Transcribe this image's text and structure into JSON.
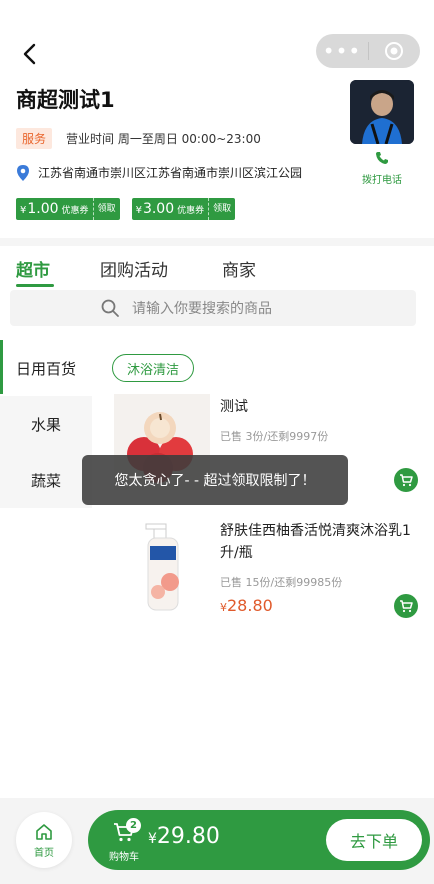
{
  "topbar": {
    "back_icon": "chevron-left-icon",
    "more_icon": "more-dots-icon",
    "close_icon": "target-icon"
  },
  "store": {
    "name": "商超测试1",
    "service_tag": "服务",
    "hours": "营业时间 周一至周日 00:00~23:00",
    "address": "江苏省南通市崇川区江苏省南通市崇川区滨江公园",
    "call_label": "拨打电话"
  },
  "coupons": [
    {
      "currency": "¥",
      "amount": "1.00",
      "kind": "优惠券",
      "action": "领取"
    },
    {
      "currency": "¥",
      "amount": "3.00",
      "kind": "优惠券",
      "action": "领取"
    }
  ],
  "tabs": [
    {
      "label": "超市"
    },
    {
      "label": "团购活动"
    },
    {
      "label": "商家"
    }
  ],
  "search": {
    "placeholder": "请输入你要搜索的商品"
  },
  "categories": [
    {
      "label": "日用百货"
    },
    {
      "label": "水果"
    },
    {
      "label": "蔬菜"
    }
  ],
  "subcategory": {
    "label": "沐浴清洁"
  },
  "products": [
    {
      "title": "测试",
      "sold": "已售 3份/还剩9997份",
      "price_currency": "",
      "price": ""
    },
    {
      "title": "舒肤佳西柚香活悦清爽沐浴乳1升/瓶",
      "sold": "已售 15份/还剩99985份",
      "price_currency": "¥",
      "price": "28.80"
    }
  ],
  "toast": {
    "message": "您太贪心了- - 超过领取限制了！"
  },
  "bottom": {
    "home_label": "首页",
    "cart_label": "购物车",
    "cart_count": "2",
    "total_currency": "¥",
    "total": "29.80",
    "order_label": "去下单"
  },
  "colors": {
    "accent": "#2f9a41",
    "price": "#e05a2b",
    "service_tag": "#e9652c"
  }
}
